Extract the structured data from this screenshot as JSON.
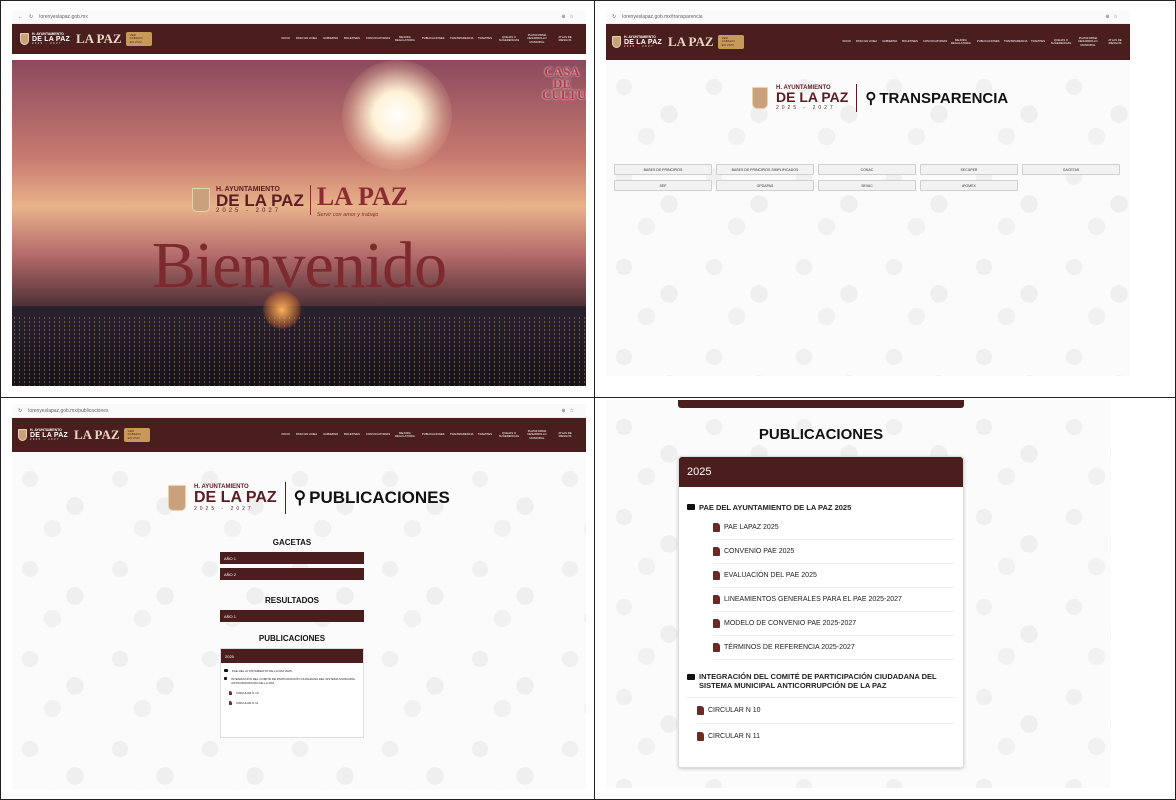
{
  "browser": {
    "url_home": "lorenyeslapaz.gob.mx",
    "url_transparencia": "lorenyeslapaz.gob.mx/transparencia",
    "url_publicaciones": "lorenyeslapaz.gob.mx/publicaciones"
  },
  "brand": {
    "ayuntamiento": "H. AYUNTAMIENTO",
    "de_la_paz": "DE LA PAZ",
    "years": "2025 - 2027",
    "lapaz": "LA PAZ",
    "slogan": "Servir con amor y trabajo",
    "pill": "VER CABILDO EN VIVO"
  },
  "nav": [
    "INICIO",
    "PASO EN LINEA",
    "GOBIERNO",
    "BOLETINES",
    "CONVOCATORIAS",
    "MEJORA REGULATORIA",
    "PUBLICACIONES",
    "TRANSPARENCIA",
    "TRAMITES",
    "QUEJAS O SUGERENCIAS",
    "PLATAFORMA DESARROLLO MUNICIPAL",
    "ATLAS DE RIESGOS"
  ],
  "home": {
    "casa": "CASA DE CULTURA",
    "welcome": "Bienvenido"
  },
  "transparencia": {
    "title": "TRANSPARENCIA",
    "buttons_row1": [
      "BASES DE PRINCIPIOS",
      "BASES DE PRINCIPIOS SIMPLIFICADOS",
      "CONAC",
      "SECUPER",
      "GACETAS"
    ],
    "buttons_row2": [
      "SEP",
      "OPDAPAS",
      "SEVAC",
      "IPOMEX"
    ]
  },
  "publicaciones": {
    "title": "PUBLICACIONES",
    "gacetas": "GACETAS",
    "gacetas_items": [
      "AÑO 1",
      "AÑO 2"
    ],
    "resultados": "RESULTADOS",
    "resultados_items": [
      "AÑO 1"
    ],
    "pub_title": "PUBLICACIONES",
    "year": "2025",
    "folder1": "PAE DEL AYUNTAMIENTO DE LA PAZ 2025",
    "folder2": "INTEGRACIÓN DEL COMITÉ DE PARTICIPACIÓN CIUDADANA DEL SISTEMA MUNICIPAL ANTICORRUPCIÓN DE LA PAZ",
    "small_files": [
      "CIRCULAR N 10",
      "CIRCULAR N 11"
    ]
  },
  "detail": {
    "title": "PUBLICACIONES",
    "year": "2025",
    "folder1": "PAE DEL AYUNTAMIENTO DE LA PAZ 2025",
    "folder1_files": [
      "PAE LAPAZ 2025",
      "CONVENIO PAE 2025",
      "EVALUACIÓN DEL PAE 2025",
      "LINEAMIENTOS GENERALES PARA EL PAE 2025-2027",
      "MODELO DE CONVENIO PAE 2025-2027",
      "TÉRMINOS DE REFERENCIA 2025-2027"
    ],
    "folder2": "INTEGRACIÓN DEL COMITÉ DE PARTICIPACIÓN CIUDADANA DEL SISTEMA MUNICIPAL ANTICORRUPCIÓN DE LA PAZ",
    "folder2_files": [
      "CIRCULAR N 10",
      "CIRCULAR N 11"
    ]
  }
}
